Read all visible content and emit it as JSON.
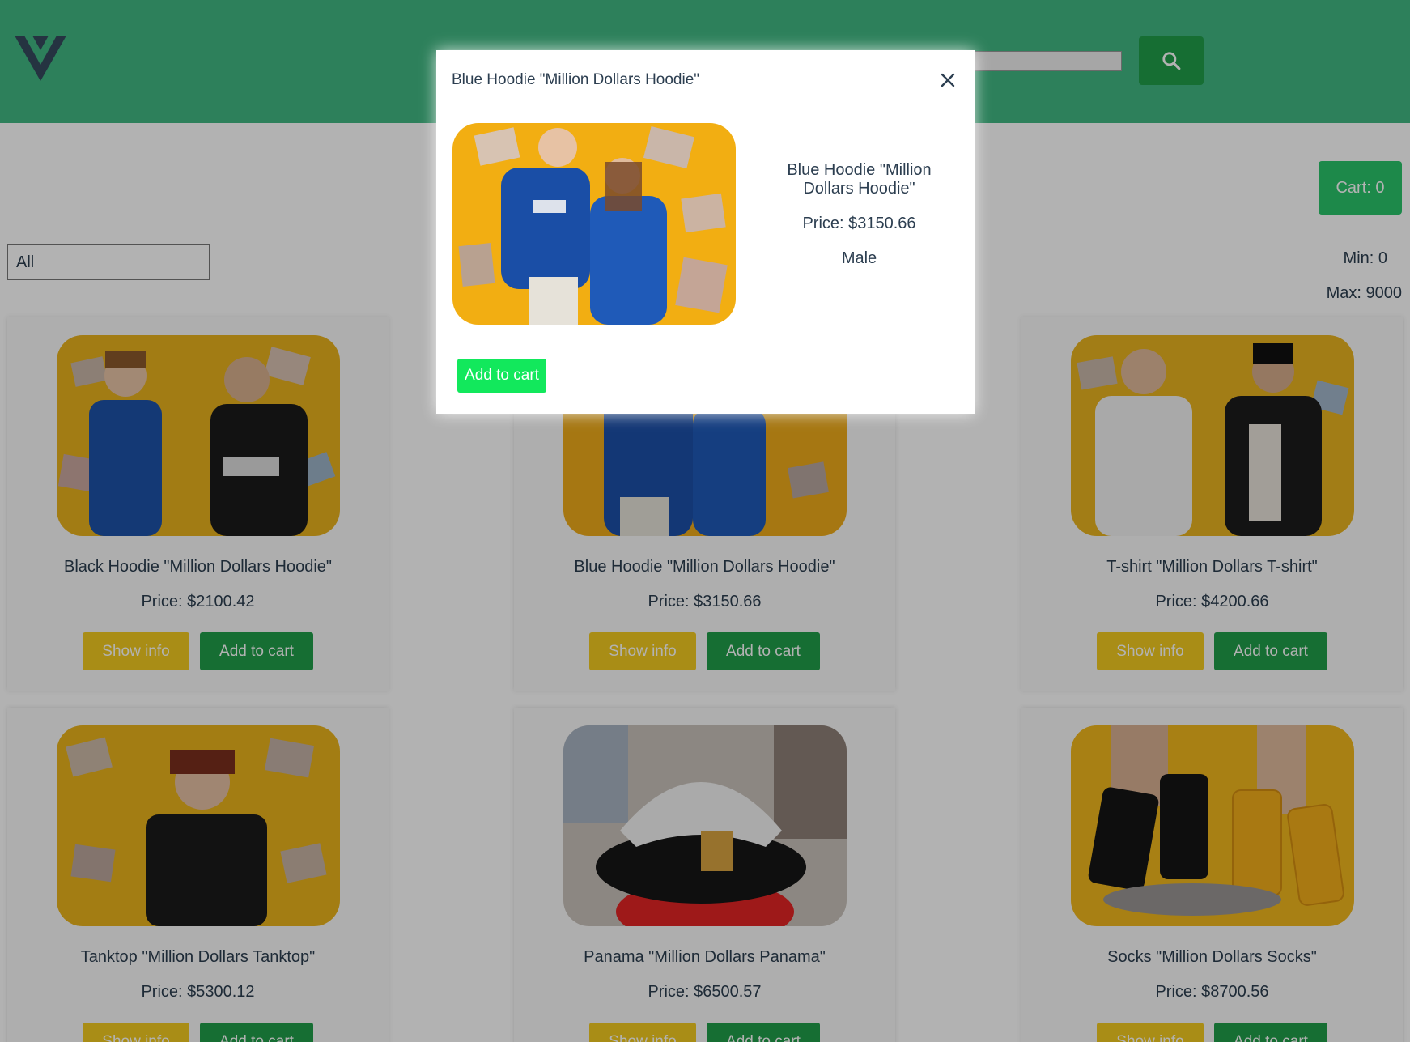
{
  "header": {
    "logo_icon": "vue-logo-icon",
    "search_icon": "search-icon",
    "search_value": ""
  },
  "cart": {
    "label": "Cart: 0"
  },
  "filter": {
    "selected": "All"
  },
  "range": {
    "min_label": "Min: 0",
    "max_label": "Max: 9000"
  },
  "products": [
    {
      "name": "Black Hoodie \"Million Dollars Hoodie\"",
      "price": "Price: $2100.42",
      "show_info": "Show info",
      "add_to_cart": "Add to cart"
    },
    {
      "name": "Blue Hoodie \"Million Dollars Hoodie\"",
      "price": "Price: $3150.66",
      "show_info": "Show info",
      "add_to_cart": "Add to cart"
    },
    {
      "name": "T-shirt \"Million Dollars T-shirt\"",
      "price": "Price: $4200.66",
      "show_info": "Show info",
      "add_to_cart": "Add to cart"
    },
    {
      "name": "Tanktop \"Million Dollars Tanktop\"",
      "price": "Price: $5300.12",
      "show_info": "Show info",
      "add_to_cart": "Add to cart"
    },
    {
      "name": "Panama \"Million Dollars Panama\"",
      "price": "Price: $6500.57",
      "show_info": "Show info",
      "add_to_cart": "Add to cart"
    },
    {
      "name": "Socks \"Million Dollars Socks\"",
      "price": "Price: $8700.56",
      "show_info": "Show info",
      "add_to_cart": "Add to cart"
    }
  ],
  "modal": {
    "title": "Blue Hoodie \"Million Dollars Hoodie\"",
    "close_icon": "close-icon",
    "name": "Blue Hoodie \"Million Dollars Hoodie\"",
    "price": "Price: $3150.66",
    "gender": "Male",
    "add_to_cart": "Add to cart"
  },
  "colors": {
    "header_bg": "#41b883",
    "primary_button": "#209e4a",
    "info_button": "#f2cb20",
    "modal_add_button": "#12e85c",
    "cart_button": "#2ac46b",
    "text": "#2c3e50"
  }
}
